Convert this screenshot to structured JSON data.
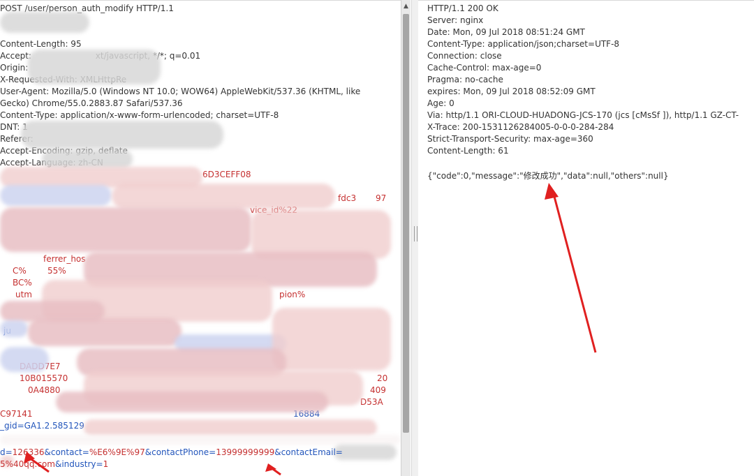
{
  "request": {
    "lines": [
      "POST /user/person_auth_modify HTTP/1.1",
      "",
      "Content-Length: 95",
      "Accept: ",
      "Origin: ",
      "X-Requested-With: XMLHttpRe",
      "User-Agent: Mozilla/5.0 (Windows NT 10.0; WOW64) AppleWebKit/537.36 (KHTML, like",
      "Gecko) Chrome/55.0.2883.87 Safari/537.36",
      "Content-Type: application/x-www-form-urlencoded; charset=UTF-8",
      "DNT: 1",
      "Referer: ",
      "Accept-Encoding: gzip, deflate",
      "Accept-Language: zh-CN"
    ],
    "accept_tail": "xt/javascript, */*; q=0.01",
    "cookie_fragments": [
      "6D3CEFF08",
      "fdc3",
      "97",
      "vice_id%22",
      "ferrer_hos",
      "C%",
      "55%",
      "BC%",
      "utm",
      "pion%",
      "ju",
      "DADD7E7",
      "10B015570",
      "20",
      "0A4880",
      "409",
      "C97141",
      "_gid=GA1.2.585129",
      "D53A",
      "16884"
    ],
    "body_line1": {
      "p1": "d=",
      "v1": "126336",
      "p2": "&contact=",
      "v2": "%E6%9E%97",
      "p3": "&contactPhone=",
      "v3": "13999999999",
      "p4": "&contactEmail="
    },
    "body_line2": {
      "v1": "5%40qq.com",
      "p2": "&industry=",
      "v2": "1"
    }
  },
  "response": {
    "lines": [
      "HTTP/1.1 200 OK",
      "Server: nginx",
      "Date: Mon, 09 Jul 2018 08:51:24 GMT",
      "Content-Type: application/json;charset=UTF-8",
      "Connection: close",
      "Cache-Control: max-age=0",
      "Pragma: no-cache",
      "expires: Mon, 09 Jul 2018 08:52:09 GMT",
      "Age: 0",
      "Via: http/1.1 ORI-CLOUD-HUADONG-JCS-170 (jcs [cMsSf ]), http/1.1 GZ-CT-",
      "X-Trace: 200-1531126284005-0-0-0-284-284",
      "Strict-Transport-Security: max-age=360",
      "Content-Length: 61",
      "",
      "{\"code\":0,\"message\":\"修改成功\",\"data\":null,\"others\":null}"
    ]
  },
  "colors": {
    "param_name": "#2255bb",
    "param_value": "#c53030",
    "annotation_arrow": "#e02020"
  }
}
